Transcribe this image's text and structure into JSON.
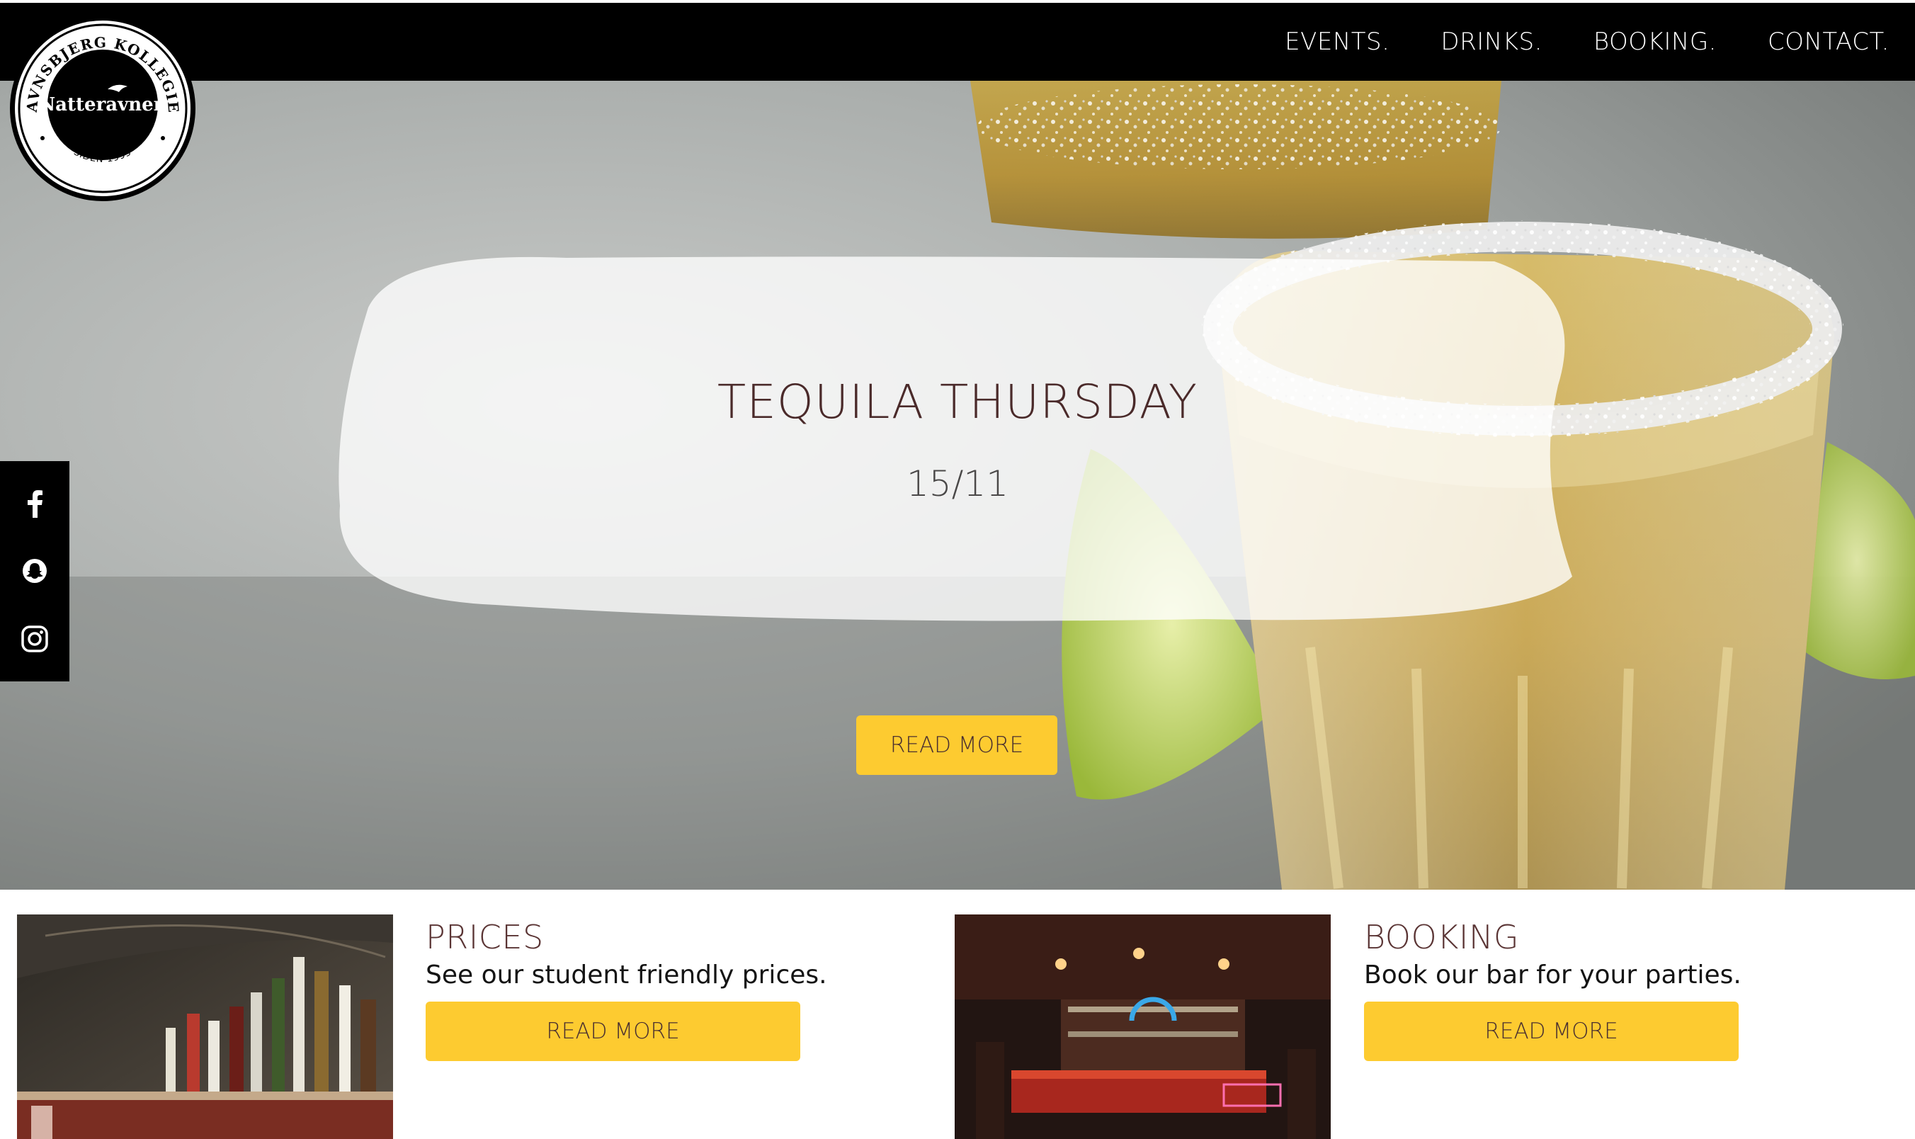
{
  "logo": {
    "arc_top": "RAVNSBJERG KOLLEGIET",
    "center": "Natteravnen",
    "bottom": "SIDEN 1995"
  },
  "nav": {
    "items": [
      "EVENTS.",
      "DRINKS.",
      "BOOKING.",
      "CONTACT."
    ]
  },
  "hero": {
    "title": "TEQUILA THURSDAY",
    "date": "15/11",
    "button_label": "READ MORE"
  },
  "social": {
    "icons": [
      "facebook-icon",
      "snapchat-icon",
      "instagram-icon"
    ]
  },
  "cards": [
    {
      "title": "PRICES",
      "text": "See our student friendly prices.",
      "button_label": "READ MORE"
    },
    {
      "title": "BOOKING",
      "text": "Book our bar for your parties.",
      "button_label": "READ MORE"
    }
  ],
  "colors": {
    "nav_bg": "#000000",
    "accent_yellow": "#fdcb30",
    "heading_brown": "#5a3434"
  }
}
